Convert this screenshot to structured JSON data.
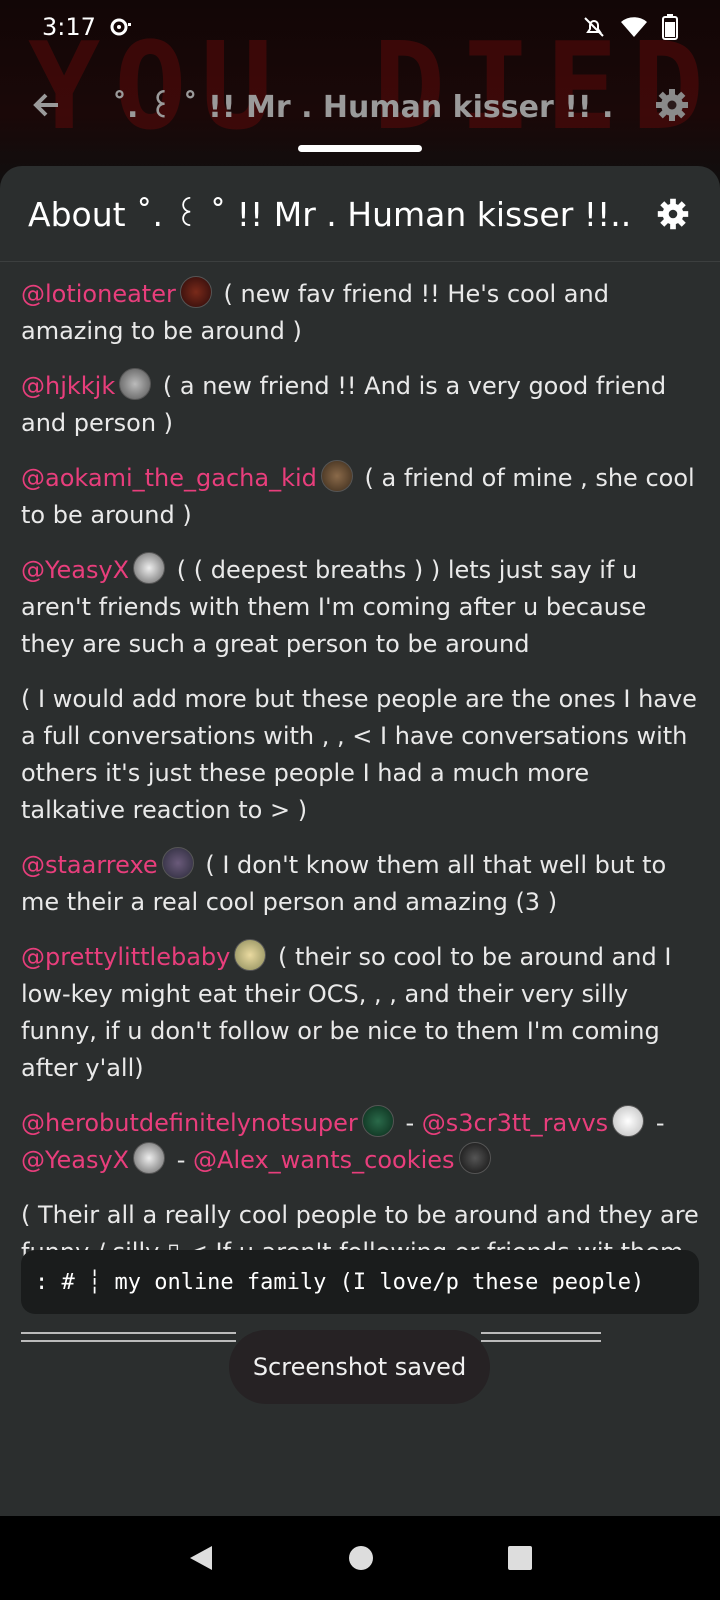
{
  "status_bar": {
    "time": "3:17"
  },
  "profile_nav": {
    "title": "˚. ꒰ ˚ !! Mr . Human kisser !! ."
  },
  "banner": {
    "text": "YOU DIED!"
  },
  "sheet": {
    "title": "About ˚. ꒰ ˚ !! Mr . Human kisser !!..."
  },
  "content": {
    "p1": {
      "mention": "@lotioneater",
      "text": "( new fav friend !! He's cool and amazing to be around )"
    },
    "p2": {
      "mention": "@hjkkjk",
      "text": "( a new friend !! And is a very good friend and person )"
    },
    "p3": {
      "mention": "@aokami_the_gacha_kid",
      "text": "( a friend of mine , she cool to be around )"
    },
    "p4": {
      "mention": "@YeasyX",
      "text": "( ( deepest breaths ) ) lets just say if u aren't friends with them I'm coming after u because they are such a great person to be around"
    },
    "p5": {
      "text": "( I would add more but these people are the ones I have a full conversations with , , < I have conversations with others it's just these people I had a much more talkative reaction to > )"
    },
    "p6": {
      "mention": "@staarrexe",
      "text": "( I don't know them all that well but to me their a real cool person and amazing  (3 )"
    },
    "p7": {
      "mention": "@prettylittlebaby",
      "text": "( their so cool to be around and I low-key might eat their OCS, , ,  and their very silly funny, if u don't follow or be nice to them I'm coming after y'all)"
    },
    "p8": {
      "m1": "@herobutdefinitelynotsuper",
      "m2": "@s3cr3tt_ravvs",
      "m3": "@YeasyX",
      "m4": "@Alex_wants_cookies",
      "sep": "-"
    },
    "p9": {
      "text": "( Their all a really cool people to be around and they are funny / silly ▯ < If u aren't following or friends wit them I'm coming after u > )"
    }
  },
  "code_box": {
    "text": ": # ┆ my online family (I love/p these people)"
  },
  "toast": {
    "text": "Screenshot saved"
  },
  "colors": {
    "mention": "#e83e7c",
    "sheet_bg": "#2b2e2e"
  }
}
